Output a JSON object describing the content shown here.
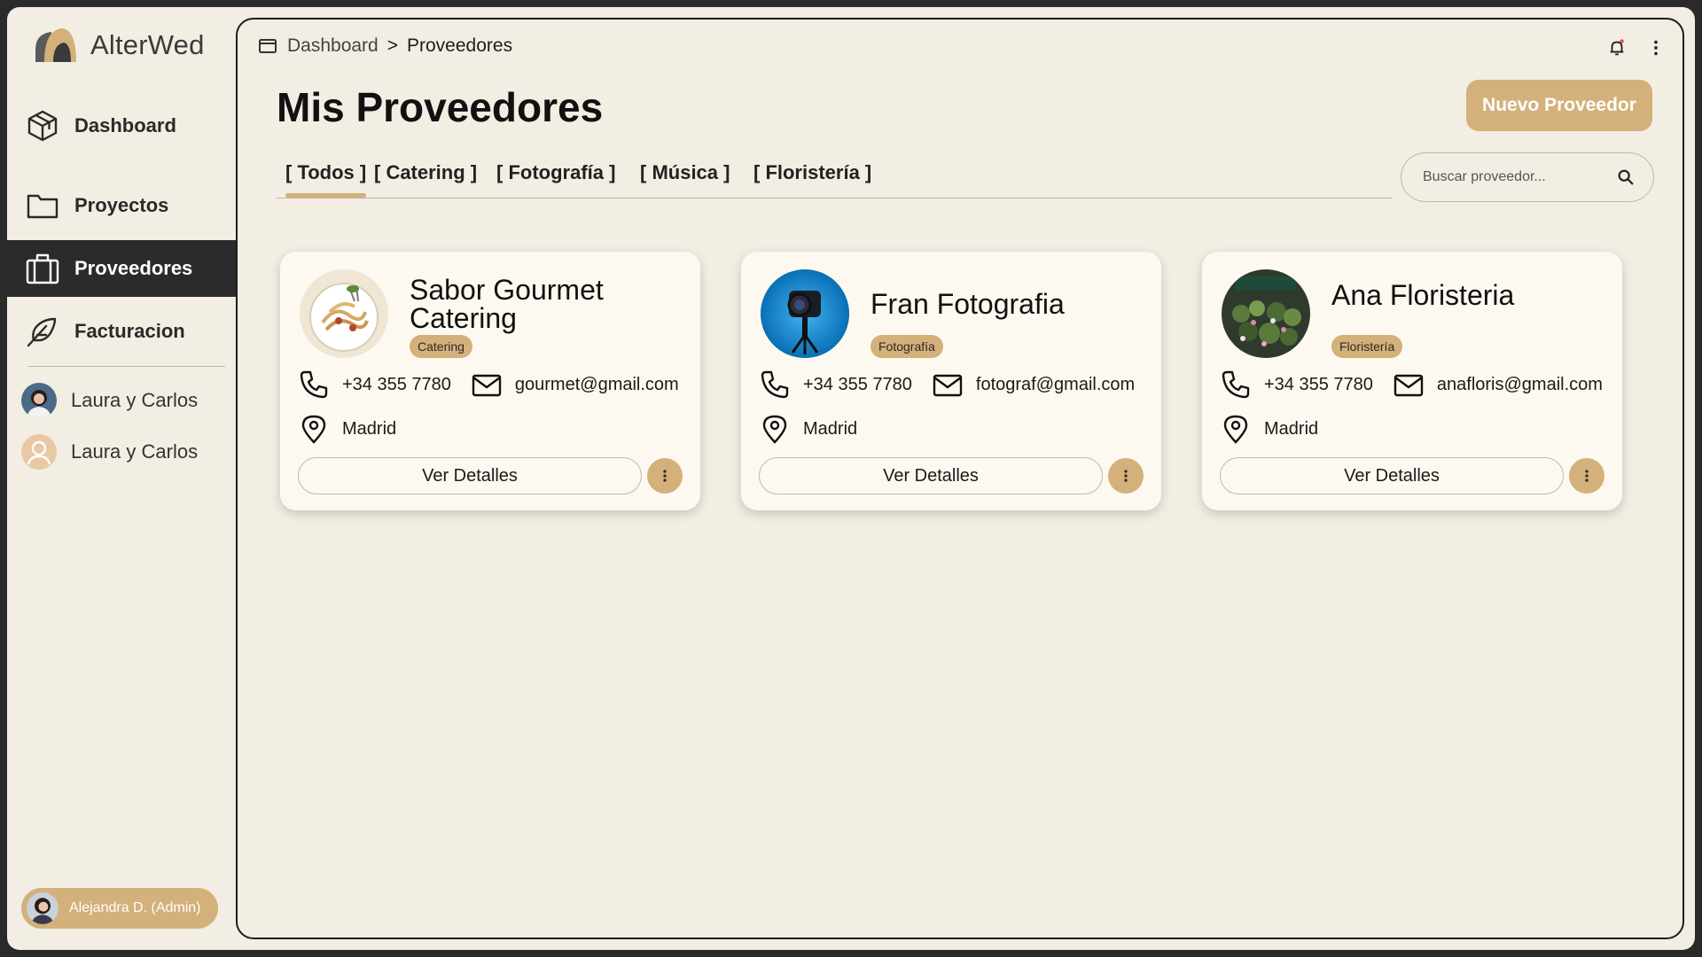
{
  "app": {
    "name": "AlterWed"
  },
  "sidebar": {
    "nav": [
      {
        "label": "Dashboard"
      },
      {
        "label": "Proyectos"
      },
      {
        "label": "Proveedores"
      },
      {
        "label": "Facturacion"
      }
    ],
    "projects": [
      {
        "label": "Laura y Carlos"
      },
      {
        "label": "Laura y Carlos"
      }
    ],
    "user": {
      "label": "Alejandra D. (Admin)"
    }
  },
  "breadcrumb": {
    "root": "Dashboard",
    "separator": ">",
    "current": "Proveedores"
  },
  "page": {
    "title": "Mis Proveedores",
    "new_button": "Nuevo Proveedor"
  },
  "tabs": [
    {
      "label": "[ Todos ]",
      "active": true
    },
    {
      "label": "[ Catering ]"
    },
    {
      "label": "[ Fotografía ]"
    },
    {
      "label": "[ Música ]"
    },
    {
      "label": "[ Floristería ]"
    }
  ],
  "search": {
    "placeholder": "Buscar proveedor..."
  },
  "vendors": [
    {
      "name": "Sabor Gourmet Catering",
      "category": "Catering",
      "phone": "+34 355 7780",
      "email": "gourmet@gmail.com",
      "location": "Madrid",
      "button": "Ver Detalles",
      "avatar": "pasta-dish"
    },
    {
      "name": "Fran Fotografia",
      "category": "Fotografía",
      "phone": "+34 355 7780",
      "email": "fotograf@gmail.com",
      "location": "Madrid",
      "button": "Ver Detalles",
      "avatar": "camera"
    },
    {
      "name": "Ana Floristeria",
      "category": "Floristería",
      "phone": "+34 355 7780",
      "email": "anafloris@gmail.com",
      "location": "Madrid",
      "button": "Ver Detalles",
      "avatar": "flower-shop"
    }
  ],
  "colors": {
    "accent": "#d4b07a",
    "background": "#f3eee3",
    "card": "#fdf9f0",
    "active_nav": "#2b2b2b"
  }
}
